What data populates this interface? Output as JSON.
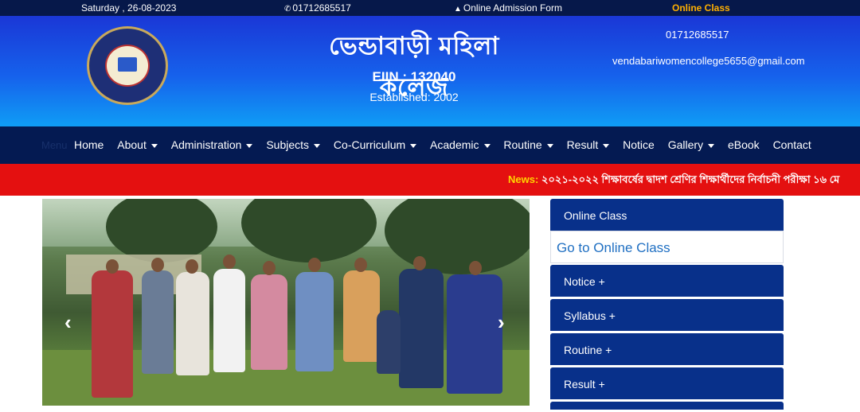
{
  "topbar": {
    "date": "Saturday , 26-08-2023",
    "phone": "01712685517",
    "admission": "Online Admission Form",
    "online_class": "Online Class"
  },
  "header": {
    "college_name": "ভেন্ডাবাড়ী মহিলা কলেজ",
    "eiin": "EIIN : 132040",
    "established": "Established: 2002",
    "phone": "01712685517",
    "email": "vendabariwomencollege5655@gmail.com"
  },
  "nav": {
    "menu_label": "Menu",
    "items": [
      {
        "label": "Home",
        "dropdown": false
      },
      {
        "label": "About",
        "dropdown": true
      },
      {
        "label": "Administration",
        "dropdown": true
      },
      {
        "label": "Subjects",
        "dropdown": true
      },
      {
        "label": "Co-Curriculum",
        "dropdown": true
      },
      {
        "label": "Academic",
        "dropdown": true
      },
      {
        "label": "Routine",
        "dropdown": true
      },
      {
        "label": "Result",
        "dropdown": true
      },
      {
        "label": "Notice",
        "dropdown": false
      },
      {
        "label": "Gallery",
        "dropdown": true
      },
      {
        "label": "eBook",
        "dropdown": false
      },
      {
        "label": "Contact",
        "dropdown": false
      }
    ]
  },
  "news": {
    "label": "News:",
    "text": "২০২১-২০২২ শিক্ষাবর্ষের দ্বাদশ শ্রেণির শিক্ষার্থীদের নির্বাচনী পরীক্ষা ১৬ মে"
  },
  "slider": {
    "prev": "‹",
    "next": "›"
  },
  "sidebar": {
    "online_class_title": "Online Class",
    "online_class_link": "Go to Online Class",
    "panels": [
      "Notice +",
      "Syllabus +",
      "Routine +",
      "Result +"
    ]
  },
  "colors": {
    "topbar": "#06184a",
    "nav": "#041a52",
    "news": "#e41010",
    "news_label": "#ffd400",
    "panel": "#08308a",
    "online_class_accent": "#ffb000"
  }
}
